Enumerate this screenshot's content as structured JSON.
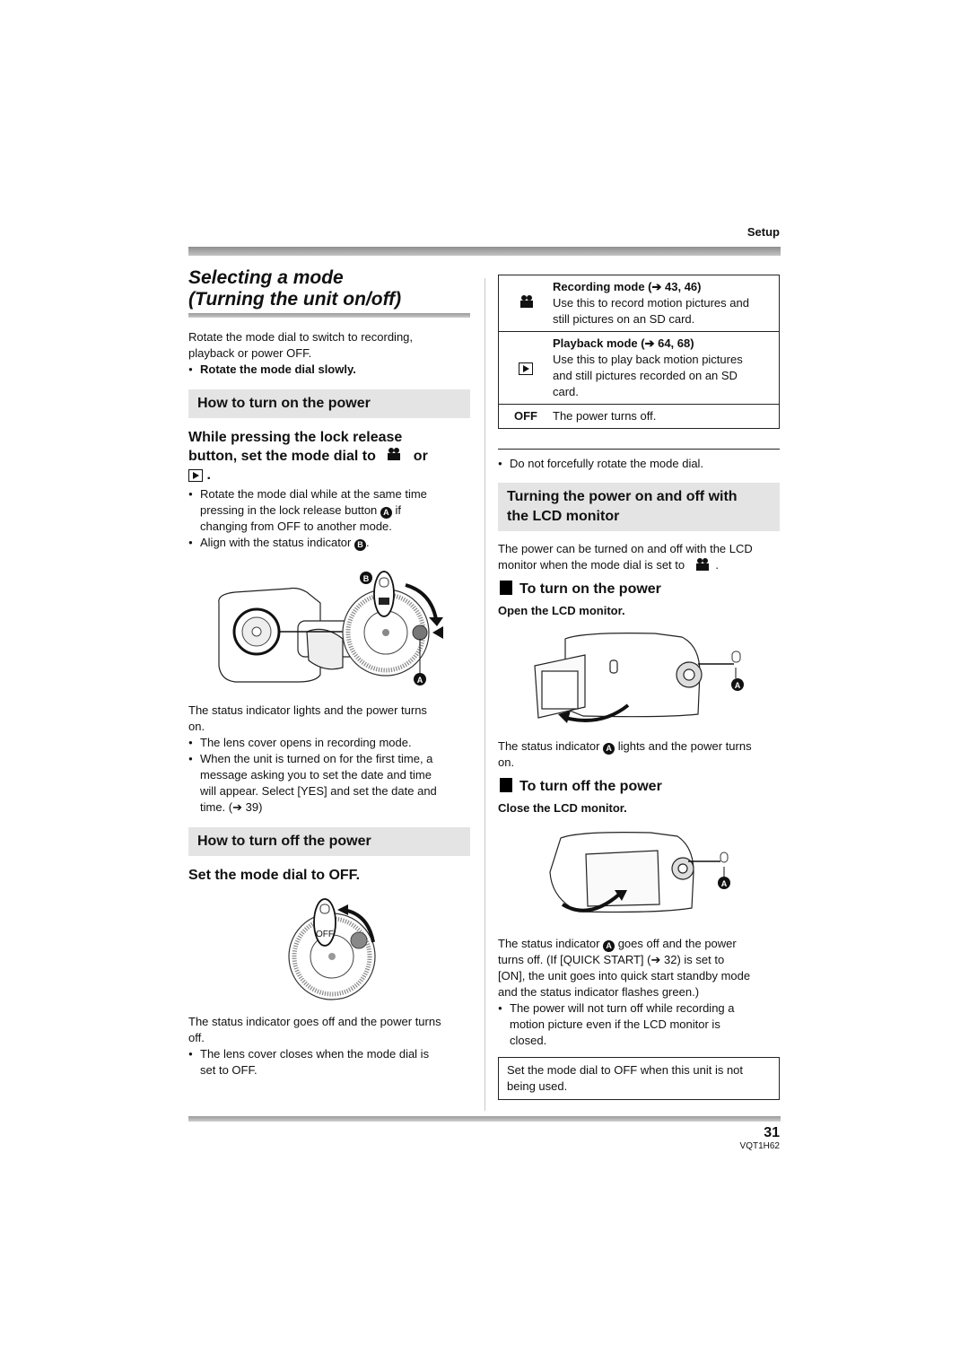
{
  "header": {
    "section": "Setup"
  },
  "title": {
    "line1": "Selecting a mode",
    "line2": "(Turning the unit on/off)"
  },
  "intro": {
    "text_line1": "Rotate the mode dial to switch to recording,",
    "text_line2": "playback or power OFF.",
    "bullet": "Rotate the mode dial slowly."
  },
  "turn_on": {
    "heading": "How to turn on the power",
    "step_line1": "While pressing the lock release",
    "step_line2": "button, set the mode dial to",
    "step_or": "or",
    "step_end": ".",
    "bullet1_line1": "Rotate the mode dial while at the same time",
    "bullet1_line2a": "pressing in the lock release button",
    "bullet1_line2b": "if",
    "bullet1_line3": "changing from OFF to another mode.",
    "bullet2": "Align with the status indicator",
    "bullet2_end": ".",
    "label_a": "A",
    "label_b": "B",
    "result_line1": "The status indicator lights and the power turns",
    "result_line2": "on.",
    "bullet3": "The lens cover opens in recording mode.",
    "bullet4_line1": "When the unit is turned on for the first time, a",
    "bullet4_line2": "message asking you to set the date and time",
    "bullet4_line3": "will appear. Select [YES] and set the date and",
    "bullet4_line4": "time. (➔ 39)"
  },
  "turn_off": {
    "heading": "How to turn off the power",
    "step": "Set the mode dial to OFF.",
    "dial_label": "OFF",
    "result_line1": "The status indicator goes off and the power turns",
    "result_line2": "off.",
    "bullet1_line1": "The lens cover closes when the mode dial is",
    "bullet1_line2": "set to OFF."
  },
  "mode_table": {
    "rows": [
      {
        "icon": "camera-icon",
        "title": "Recording mode (➔ 43, 46)",
        "line1": "Use this to record motion pictures and",
        "line2": "still pictures on an SD card."
      },
      {
        "icon": "play-icon",
        "title": "Playback mode (➔ 64, 68)",
        "line1": "Use this to play back motion pictures",
        "line2": "and still pictures recorded on an SD",
        "line3": "card."
      },
      {
        "label": "OFF",
        "line1": "The power turns off."
      }
    ]
  },
  "note": "Do not forcefully rotate the mode dial.",
  "lcd": {
    "heading_line1": "Turning the power on and off with",
    "heading_line2": "the LCD monitor",
    "intro_line1": "The power can be turned on and off with the LCD",
    "intro_line2": "monitor when the mode dial is set to",
    "intro_end": ".",
    "on_heading": "To turn on the power",
    "on_step": "Open the LCD monitor.",
    "on_result_a": "The status indicator",
    "on_result_b": "lights and the power turns",
    "on_result_line2": "on.",
    "off_heading": "To turn off the power",
    "off_step": "Close the LCD monitor.",
    "off_result_1a": "The status indicator",
    "off_result_1b": "goes off and the power",
    "off_result_2": "turns off. (If [QUICK START] (➔ 32) is set to",
    "off_result_3": "[ON], the unit goes into quick start standby mode",
    "off_result_4": "and the status indicator flashes green.)",
    "off_bullet_1": "The power will not turn off while recording a",
    "off_bullet_2": "motion picture even if the LCD monitor is",
    "off_bullet_3": "closed.",
    "label_a": "A"
  },
  "boxed_note": {
    "line1": "Set the mode dial to OFF when this unit is not",
    "line2": "being used."
  },
  "footer": {
    "page": "31",
    "code": "VQT1H62"
  }
}
